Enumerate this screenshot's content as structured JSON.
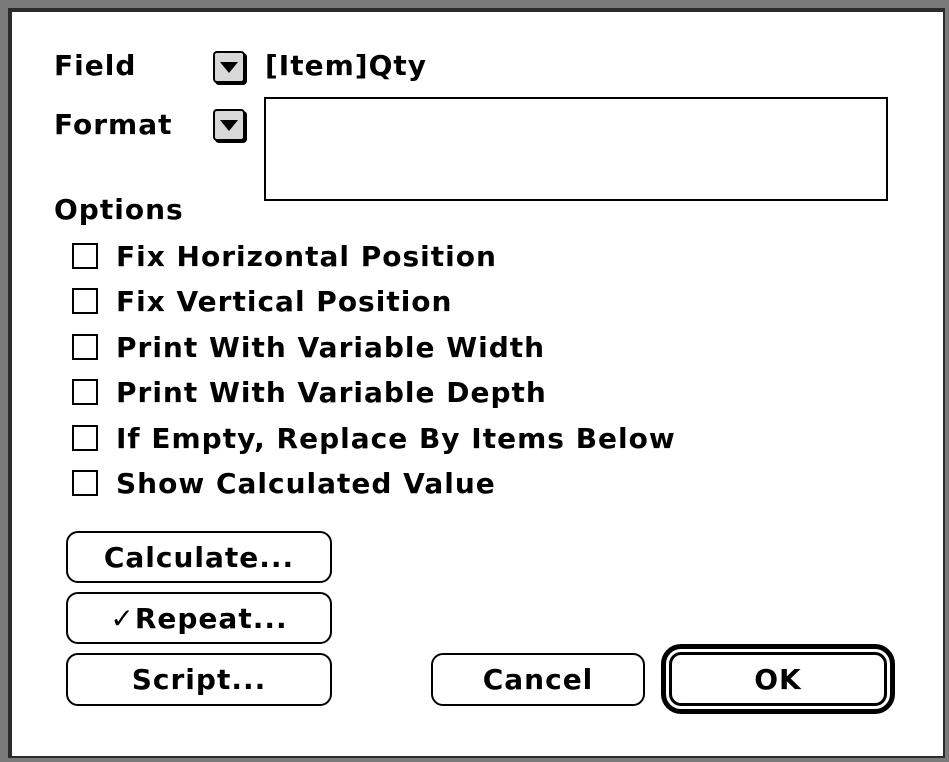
{
  "dialog": {
    "field_label": "Field",
    "field_value": "[Item]Qty",
    "format_label": "Format",
    "format_value": "",
    "options_label": "Options",
    "options": [
      {
        "label": "Fix Horizontal Position",
        "checked": false
      },
      {
        "label": "Fix Vertical Position",
        "checked": false
      },
      {
        "label": "Print With Variable Width",
        "checked": false
      },
      {
        "label": "Print With Variable Depth",
        "checked": false
      },
      {
        "label": "If Empty, Replace By Items Below",
        "checked": false
      },
      {
        "label": "Show Calculated Value",
        "checked": false
      }
    ],
    "buttons": {
      "calculate": "Calculate...",
      "repeat": "✓Repeat...",
      "script": "Script...",
      "cancel": "Cancel",
      "ok": "OK"
    },
    "popup_icon": "triangle-down-icon"
  }
}
